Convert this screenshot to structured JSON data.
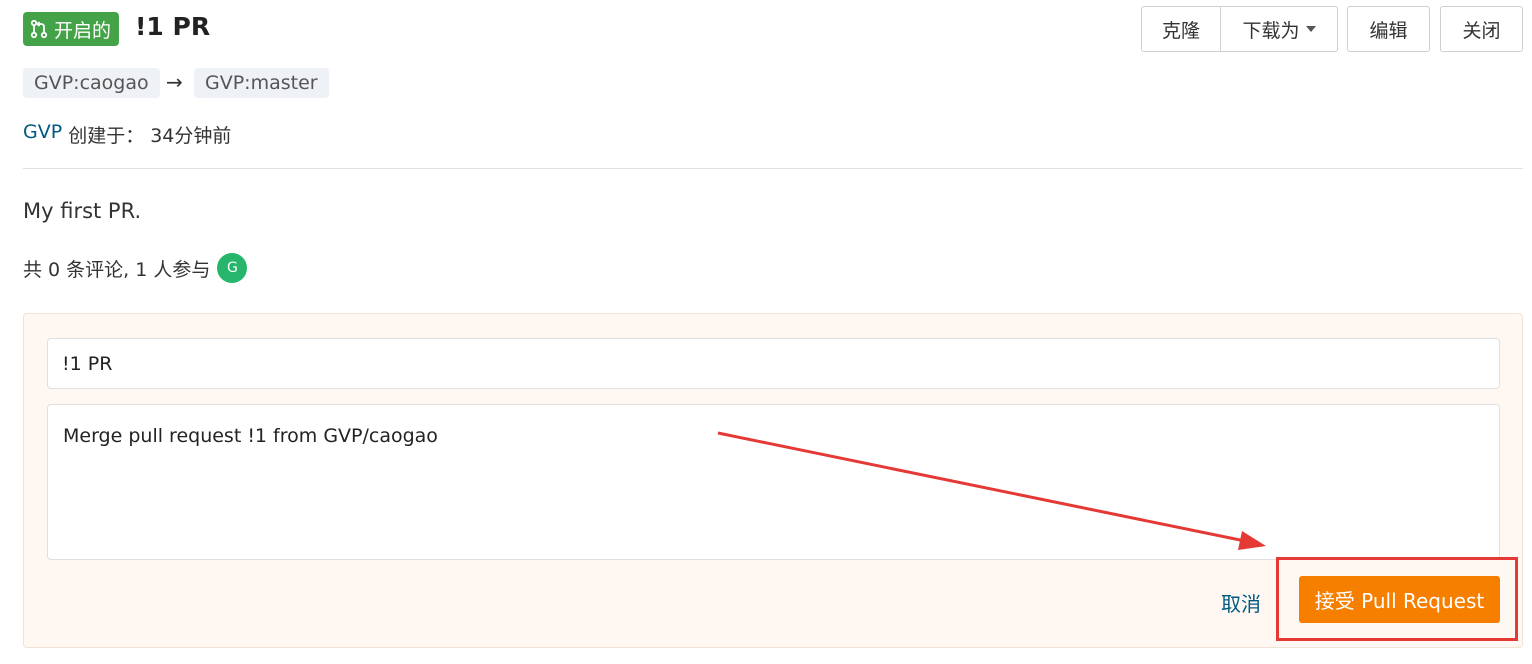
{
  "header": {
    "status": "开启的",
    "title": "!1 PR",
    "actions": {
      "clone": "克隆",
      "download": "下载为",
      "edit": "编辑",
      "close": "关闭"
    }
  },
  "branches": {
    "source": "GVP:caogao",
    "arrow": "→",
    "target": "GVP:master"
  },
  "meta": {
    "author": "GVP",
    "created_label": "创建于：",
    "created_time": "34分钟前"
  },
  "description": "My first PR.",
  "comments": {
    "summary": "共 0 条评论, 1 人参与",
    "participant_initial": "G"
  },
  "merge": {
    "title_value": "!1 PR",
    "message_value": "Merge pull request !1 from GVP/caogao",
    "cancel_label": "取消",
    "accept_label": "接受 Pull Request"
  },
  "colors": {
    "status_badge": "#44a348",
    "accept_button": "#f77f00",
    "annotation": "#e53935",
    "link": "#005980"
  }
}
